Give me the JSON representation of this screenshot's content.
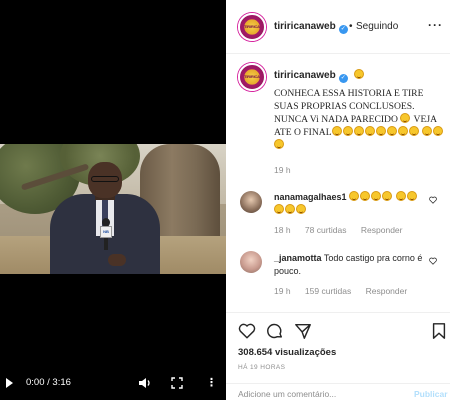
{
  "video": {
    "time_display": "0:00 / 3:16",
    "mic_flag_text": "NB"
  },
  "header": {
    "username": "tiriricanaweb",
    "separator": "•",
    "follow_label": "Seguindo",
    "more_label": "···",
    "avatar_text": "TIRIRICA"
  },
  "caption": {
    "username": "tiriricanaweb",
    "text_part1": "CONHECA ESSA HISTORIA E TIRE SUAS PROPRIAS CONCLUSOES. NUNCA Vi NADA PARECIDO",
    "text_part2": "VEJA ATE O FINAL",
    "time": "19 h"
  },
  "comments": [
    {
      "username": "nanamagalhaes1",
      "text": "",
      "time": "18 h",
      "likes": "78 curtidas",
      "reply_label": "Responder"
    },
    {
      "username": "_janamotta",
      "text": "Todo castigo pra corno é pouco.",
      "time": "19 h",
      "likes": "159 curtidas",
      "reply_label": "Responder"
    }
  ],
  "stats": {
    "views": "308.654 visualizações",
    "posted_ago": "HÁ 19 HORAS"
  },
  "add_comment": {
    "placeholder": "Adicione um comentário...",
    "publish_label": "Publicar"
  },
  "colors": {
    "verified": "#3897f0",
    "meta_gray": "#8e8e8e",
    "publish_disabled": "#b2dffc"
  }
}
